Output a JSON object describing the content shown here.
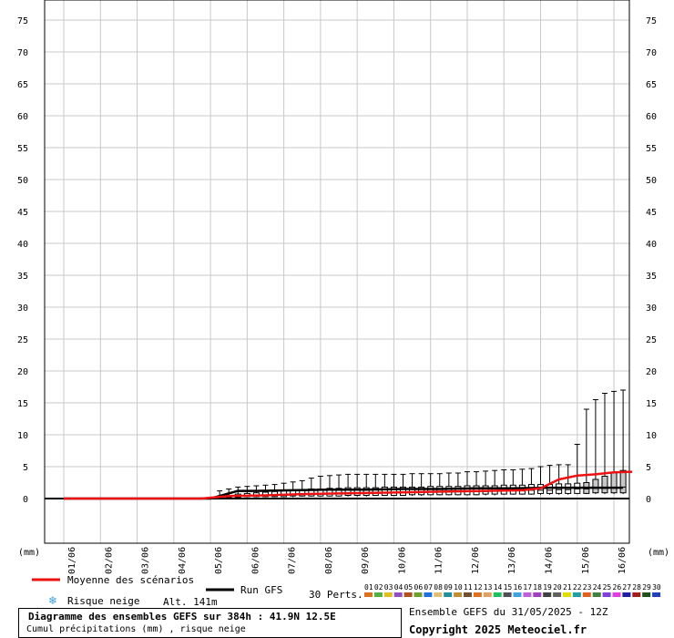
{
  "chart_data": {
    "type": "boxplot",
    "ylim": [
      0,
      75
    ],
    "yticks": [
      0,
      5,
      10,
      15,
      20,
      25,
      30,
      35,
      40,
      45,
      50,
      55,
      60,
      65,
      70,
      75
    ],
    "ylabel_left": "(mm)",
    "ylabel_right": "(mm)",
    "x_ticklabels": [
      "01/06",
      "02/06",
      "03/06",
      "04/06",
      "05/06",
      "06/06",
      "07/06",
      "08/06",
      "09/06",
      "10/06",
      "11/06",
      "12/06",
      "13/06",
      "14/06",
      "15/06",
      "16/06"
    ],
    "grid": true,
    "legend": {
      "mean": {
        "label": "Moyenne des scénarios",
        "color": "#ee1111"
      },
      "run": {
        "label": "Run GFS",
        "color": "#000000"
      },
      "snow": {
        "label": "Risque neige"
      },
      "altitude": "Alt. 141m",
      "perts_label": "30 Perts.",
      "perts": [
        "01",
        "02",
        "03",
        "04",
        "05",
        "06",
        "07",
        "08",
        "09",
        "10",
        "11",
        "12",
        "13",
        "14",
        "15",
        "16",
        "17",
        "18",
        "19",
        "20",
        "21",
        "22",
        "23",
        "24",
        "25",
        "26",
        "27",
        "28",
        "29",
        "30"
      ],
      "pert_colors": [
        "#e07020",
        "#50b040",
        "#e0c020",
        "#9050c0",
        "#b05020",
        "#70a030",
        "#2070e0",
        "#e0c070",
        "#2090a0",
        "#c09030",
        "#705030",
        "#e07020",
        "#e0a060",
        "#20c060",
        "#505050",
        "#40a0e0",
        "#c060e0",
        "#a040c0",
        "#404040",
        "#606060",
        "#e0e000",
        "#20a0a0",
        "#e06020",
        "#408040",
        "#8040e0",
        "#e040e0",
        "#2020a0",
        "#a02020",
        "#205020",
        "#2040c0"
      ]
    },
    "box_series": {
      "x_step_hours": 6,
      "start": "01/06",
      "min": [
        0.1,
        0.1,
        0.1,
        0.2,
        0.2,
        0.2,
        0.2,
        0.2,
        0.2,
        0.3,
        0.3,
        0.3,
        0.3,
        0.3,
        0.3,
        0.3,
        0.3,
        0.4,
        0.4,
        0.4,
        0.4,
        0.4,
        0.4,
        0.5,
        0.5,
        0.5,
        0.5,
        0.5,
        0.5,
        0.5,
        0.5,
        0.6,
        0.6,
        0.6,
        0.6,
        0.6,
        0.6,
        0.6,
        0.6,
        0.7,
        0.7,
        0.7,
        0.7,
        0.7,
        0.7,
        0.7,
        0.7,
        0.7,
        0.8,
        0.8,
        0.8,
        0.8,
        0.8,
        0.8,
        0.8
      ],
      "q1": [
        0.1,
        0.1,
        0.2,
        0.3,
        0.3,
        0.3,
        0.3,
        0.3,
        0.4,
        0.4,
        0.4,
        0.4,
        0.4,
        0.4,
        0.5,
        0.5,
        0.5,
        0.5,
        0.5,
        0.5,
        0.5,
        0.6,
        0.6,
        0.6,
        0.6,
        0.6,
        0.6,
        0.6,
        0.6,
        0.7,
        0.7,
        0.7,
        0.7,
        0.7,
        0.7,
        0.8,
        0.8,
        0.8,
        0.8,
        0.8,
        0.8,
        0.9,
        0.9,
        0.9,
        0.9,
        0.9,
        1.0,
        1.0,
        1.0,
        1.0,
        1.0,
        1.0,
        1.0,
        1.0,
        1.0
      ],
      "median": [
        0.2,
        0.2,
        0.3,
        0.4,
        0.4,
        0.5,
        0.5,
        0.6,
        0.6,
        0.7,
        0.7,
        0.7,
        0.8,
        0.8,
        0.8,
        0.8,
        0.9,
        0.9,
        0.9,
        0.9,
        1.0,
        1.0,
        1.0,
        1.0,
        1.0,
        1.1,
        1.1,
        1.1,
        1.1,
        1.1,
        1.2,
        1.2,
        1.2,
        1.2,
        1.3,
        1.3,
        1.3,
        1.4,
        1.4,
        1.5,
        1.5,
        1.6,
        1.6,
        1.7,
        1.8,
        1.8,
        1.9,
        1.9,
        2.0,
        2.0,
        2.0,
        2.0,
        2.0,
        2.0,
        2.0
      ],
      "q3": [
        0.3,
        0.5,
        0.7,
        0.8,
        0.9,
        1.0,
        1.1,
        1.2,
        1.3,
        1.4,
        1.5,
        1.5,
        1.6,
        1.6,
        1.7,
        1.7,
        1.7,
        1.7,
        1.8,
        1.8,
        1.8,
        1.8,
        1.8,
        1.9,
        1.9,
        1.9,
        1.9,
        2.0,
        2.0,
        2.0,
        2.0,
        2.1,
        2.1,
        2.1,
        2.2,
        2.2,
        2.2,
        2.3,
        2.3,
        2.4,
        2.5,
        3.0,
        3.5,
        4.0,
        4.4,
        4.6,
        4.8,
        4.9,
        5.0,
        5.0,
        5.0,
        5.0,
        5.0,
        5.0,
        5.0
      ],
      "max": [
        1.2,
        1.5,
        1.8,
        1.9,
        2.0,
        2.1,
        2.2,
        2.4,
        2.6,
        2.8,
        3.2,
        3.5,
        3.6,
        3.7,
        3.8,
        3.8,
        3.8,
        3.8,
        3.8,
        3.8,
        3.8,
        3.9,
        3.9,
        3.9,
        3.9,
        4.0,
        4.0,
        4.2,
        4.2,
        4.3,
        4.4,
        4.5,
        4.5,
        4.6,
        4.7,
        5.0,
        5.2,
        5.3,
        5.3,
        8.5,
        14.0,
        15.5,
        16.5,
        16.8,
        17.0,
        17.0,
        17.0,
        17.0,
        17.0,
        17.0,
        17.0,
        17.0,
        17.0,
        17.0,
        17.0
      ],
      "hatched_range": [
        40,
        54
      ]
    },
    "run_line": {
      "points": [
        [
          "01/06 00h",
          0
        ],
        [
          "05/06 00h",
          0
        ],
        [
          "05/06 18h",
          1.2
        ],
        [
          "06/06 06h",
          1.2
        ],
        [
          "07/06 06h",
          1.3
        ],
        [
          "08/06 06h",
          1.4
        ],
        [
          "09/06 06h",
          1.4
        ],
        [
          "10/06 06h",
          1.5
        ],
        [
          "11/06 06h",
          1.5
        ],
        [
          "12/06 06h",
          1.6
        ],
        [
          "13/06 06h",
          1.6
        ],
        [
          "14/06 06h",
          1.7
        ],
        [
          "15/06 06h",
          1.7
        ],
        [
          "16/06 06h",
          1.7
        ]
      ]
    },
    "mean_line": {
      "points": [
        [
          "01/06 00h",
          0
        ],
        [
          "04/06 18h",
          0
        ],
        [
          "05/06 12h",
          0.4
        ],
        [
          "06/06 12h",
          0.5
        ],
        [
          "07/06 12h",
          0.7
        ],
        [
          "08/06 12h",
          0.8
        ],
        [
          "09/06 12h",
          0.9
        ],
        [
          "10/06 12h",
          1.0
        ],
        [
          "11/06 12h",
          1.1
        ],
        [
          "12/06 12h",
          1.2
        ],
        [
          "13/06 12h",
          1.3
        ],
        [
          "14/06 00h",
          1.6
        ],
        [
          "14/06 12h",
          3.0
        ],
        [
          "15/06 00h",
          3.6
        ],
        [
          "15/06 12h",
          3.8
        ],
        [
          "16/06 00h",
          4.1
        ],
        [
          "16/06 12h",
          4.2
        ]
      ]
    }
  },
  "footer": {
    "title": "Diagramme des ensembles GEFS sur 384h : 41.9N 12.5E",
    "subtitle": "Cumul précipitations (mm) , risque neige",
    "ensemble": "Ensemble GEFS du 31/05/2025 - 12Z",
    "copyright": "Copyright 2025 Meteociel.fr"
  }
}
